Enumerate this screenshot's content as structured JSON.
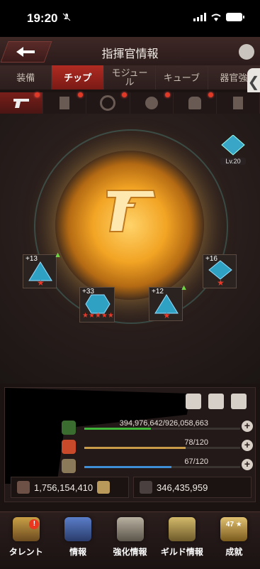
{
  "status": {
    "time": "19:20"
  },
  "header": {
    "title": "指揮官情報"
  },
  "tabs": [
    {
      "label": "装備",
      "active": false
    },
    {
      "label": "チップ",
      "active": true
    },
    {
      "label": "モジュー\nル",
      "active": false
    },
    {
      "label": "キューブ",
      "active": false
    },
    {
      "label": "器官強",
      "active": false
    }
  ],
  "subtabs": [
    "pistol-icon",
    "chip-icon",
    "ring-icon",
    "gear-icon",
    "armor-icon",
    "boot-icon"
  ],
  "badge": {
    "level": "Lv.20"
  },
  "chips": [
    {
      "level": "+13",
      "stars": "★",
      "up": true
    },
    {
      "level": "+33",
      "stars": "★★★★★",
      "up": false
    },
    {
      "level": "+12",
      "stars": "★",
      "up": true
    },
    {
      "level": "+16",
      "stars": "★",
      "up": false
    }
  ],
  "stats": {
    "hp": {
      "value": "394,976,642/926,058,663",
      "fill": 0.426,
      "color": "#3fb63a"
    },
    "ammo": {
      "value": "78/120",
      "fill": 0.65,
      "color": "#c99c4a"
    },
    "energy": {
      "value": "67/120",
      "fill": 0.558,
      "color": "#3f8fd6"
    }
  },
  "summary": {
    "power": "1,756,154,410",
    "kills": "346,435,959"
  },
  "nav": [
    {
      "label": "タレント",
      "badge": "!"
    },
    {
      "label": "情報",
      "badge": ""
    },
    {
      "label": "強化情報",
      "badge": ""
    },
    {
      "label": "ギルド情報",
      "badge": ""
    },
    {
      "label": "成就",
      "badge": "47 ★"
    }
  ],
  "colors": {
    "accent": "#b02b22",
    "gold": "#f2a424"
  }
}
